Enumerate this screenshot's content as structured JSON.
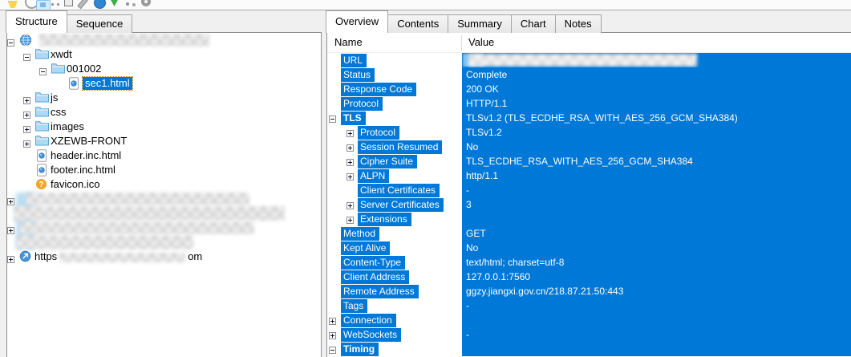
{
  "colors": {
    "accent_blue": "#0078d7",
    "selection_outline_orange": "#cf7c00",
    "favicon_orange": "#f3a42c"
  },
  "toolbar": {
    "icons": [
      {
        "name": "clear-session"
      },
      {
        "name": "record"
      },
      {
        "name": "autoscroll",
        "selected": true
      },
      {
        "name": "gauge"
      },
      {
        "name": "document"
      },
      {
        "name": "edit-pencil"
      },
      {
        "name": "proxy-globe"
      },
      {
        "name": "throttle"
      },
      {
        "name": "tools"
      },
      {
        "name": "settings-gear"
      }
    ]
  },
  "left_panel": {
    "tabs": [
      {
        "label": "Structure",
        "active": true
      },
      {
        "label": "Sequence",
        "active": false
      }
    ],
    "tree": [
      {
        "label": "",
        "depth": 0,
        "expander": "minus",
        "icon": "globe",
        "censored": "root"
      },
      {
        "label": "xwdt",
        "depth": 1,
        "expander": "minus",
        "icon": "folder"
      },
      {
        "label": "001002",
        "depth": 2,
        "expander": "minus",
        "icon": "folder"
      },
      {
        "label": "sec1.html",
        "depth": 3,
        "expander": null,
        "icon": "file",
        "selected": true
      },
      {
        "label": "js",
        "depth": 1,
        "expander": "plus",
        "icon": "folder"
      },
      {
        "label": "css",
        "depth": 1,
        "expander": "plus",
        "icon": "folder"
      },
      {
        "label": "images",
        "depth": 1,
        "expander": "plus",
        "icon": "folder"
      },
      {
        "label": "XZEWB-FRONT",
        "depth": 1,
        "expander": "plus",
        "icon": "folder"
      },
      {
        "label": "header.inc.html",
        "depth": 1,
        "expander": null,
        "icon": "file"
      },
      {
        "label": "footer.inc.html",
        "depth": 1,
        "expander": null,
        "icon": "file"
      },
      {
        "label": "favicon.ico",
        "depth": 1,
        "expander": null,
        "icon": "question"
      },
      {
        "label": "",
        "depth": 0,
        "expander": "plus",
        "icon": null,
        "censored": "site1"
      },
      {
        "label": "",
        "depth": 0,
        "expander": null,
        "icon": null,
        "censored": "block1"
      },
      {
        "label": "",
        "depth": 0,
        "expander": "plus",
        "icon": null,
        "censored": "site2"
      },
      {
        "label": "",
        "depth": 0,
        "expander": null,
        "icon": null,
        "censored": "block2"
      },
      {
        "label_prefix": "https",
        "label_suffix": "om",
        "depth": 0,
        "expander": "plus",
        "icon": "site",
        "censored": "partial"
      }
    ]
  },
  "right_panel": {
    "tabs": [
      {
        "label": "Overview",
        "active": true
      },
      {
        "label": "Contents",
        "active": false
      },
      {
        "label": "Summary",
        "active": false
      },
      {
        "label": "Chart",
        "active": false
      },
      {
        "label": "Notes",
        "active": false
      }
    ],
    "columns": [
      "Name",
      "Value"
    ],
    "rows": [
      {
        "name": "URL",
        "value": "",
        "depth": 0,
        "expander": null,
        "value_redacted": true
      },
      {
        "name": "Status",
        "value": "Complete",
        "depth": 0,
        "expander": null
      },
      {
        "name": "Response Code",
        "value": "200 OK",
        "depth": 0,
        "expander": null
      },
      {
        "name": "Protocol",
        "value": "HTTP/1.1",
        "depth": 0,
        "expander": null
      },
      {
        "name": "TLS",
        "value": "TLSv1.2 (TLS_ECDHE_RSA_WITH_AES_256_GCM_SHA384)",
        "depth": 0,
        "expander": "minus",
        "bold": true
      },
      {
        "name": "Protocol",
        "value": "TLSv1.2",
        "depth": 1,
        "expander": "plus"
      },
      {
        "name": "Session Resumed",
        "value": "No",
        "depth": 1,
        "expander": "plus"
      },
      {
        "name": "Cipher Suite",
        "value": "TLS_ECDHE_RSA_WITH_AES_256_GCM_SHA384",
        "depth": 1,
        "expander": "plus"
      },
      {
        "name": "ALPN",
        "value": "http/1.1",
        "depth": 1,
        "expander": "plus"
      },
      {
        "name": "Client Certificates",
        "value": "-",
        "depth": 1,
        "expander": null
      },
      {
        "name": "Server Certificates",
        "value": "3",
        "depth": 1,
        "expander": "plus"
      },
      {
        "name": "Extensions",
        "value": "",
        "depth": 1,
        "expander": "plus"
      },
      {
        "name": "Method",
        "value": "GET",
        "depth": 0,
        "expander": null
      },
      {
        "name": "Kept Alive",
        "value": "No",
        "depth": 0,
        "expander": null
      },
      {
        "name": "Content-Type",
        "value": "text/html; charset=utf-8",
        "depth": 0,
        "expander": null
      },
      {
        "name": "Client Address",
        "value": "127.0.0.1:7560",
        "depth": 0,
        "expander": null
      },
      {
        "name": "Remote Address",
        "value": "ggzy.jiangxi.gov.cn/218.87.21.50:443",
        "depth": 0,
        "expander": null
      },
      {
        "name": "Tags",
        "value": "-",
        "depth": 0,
        "expander": null
      },
      {
        "name": "Connection",
        "value": "",
        "depth": 0,
        "expander": "plus"
      },
      {
        "name": "WebSockets",
        "value": "-",
        "depth": 0,
        "expander": "plus"
      },
      {
        "name": "Timing",
        "value": "",
        "depth": 0,
        "expander": "minus",
        "bold": true
      }
    ]
  }
}
